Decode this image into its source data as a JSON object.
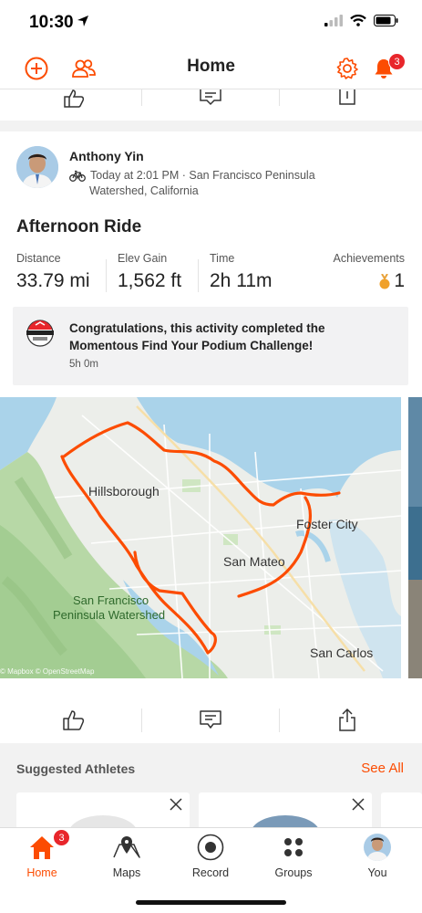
{
  "status_bar": {
    "time": "10:30"
  },
  "nav": {
    "title": "Home",
    "notification_count": "3"
  },
  "activity": {
    "athlete_name": "Anthony Yin",
    "meta_line1": "Today at 2:01 PM · San Francisco Peninsula",
    "meta_line2": "Watershed, California",
    "title": "Afternoon Ride",
    "stats": [
      {
        "label": "Distance",
        "value": "33.79 mi"
      },
      {
        "label": "Elev Gain",
        "value": "1,562 ft"
      },
      {
        "label": "Time",
        "value": "2h 11m"
      },
      {
        "label": "Achievements",
        "value": "1"
      }
    ],
    "challenge": {
      "text": "Congratulations, this activity completed the Momentous Find Your Podium Challenge!",
      "time": "5h 0m"
    },
    "map": {
      "labels": [
        "Hillsborough",
        "Foster City",
        "San Mateo",
        "San Francisco",
        "Peninsula Watershed",
        "San Carlos"
      ],
      "attribution": "© Mapbox © OpenStreetMap"
    }
  },
  "suggested": {
    "title": "Suggested Athletes",
    "see_all": "See All"
  },
  "tabs": [
    {
      "label": "Home",
      "badge": "3"
    },
    {
      "label": "Maps"
    },
    {
      "label": "Record"
    },
    {
      "label": "Groups"
    },
    {
      "label": "You"
    }
  ],
  "colors": {
    "accent": "#fc4c02",
    "badge": "#e8262b",
    "route": "#fc4c02"
  }
}
